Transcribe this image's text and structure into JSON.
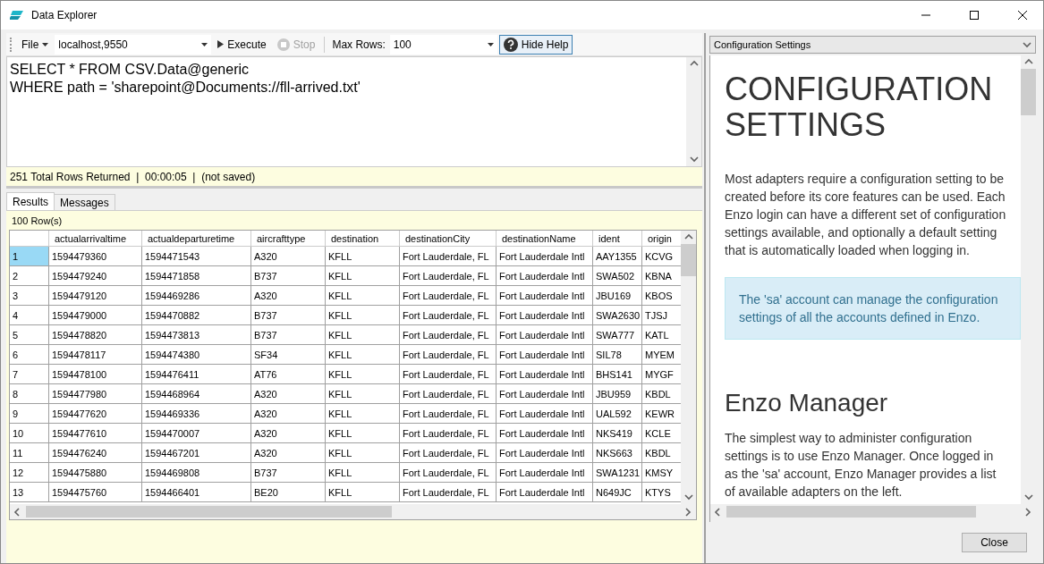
{
  "window": {
    "title": "Data Explorer"
  },
  "toolbar": {
    "file_menu": "File",
    "server": "localhost,9550",
    "execute": "Execute",
    "stop": {
      "label": "Stop",
      "disabled": true
    },
    "max_rows_label": "Max Rows:",
    "max_rows": "100",
    "help_toggle": "Hide Help"
  },
  "query": [
    "SELECT * FROM CSV.Data@generic",
    "WHERE path = 'sharepoint@Documents://fll-arrived.txt'"
  ],
  "status_bar": "251 Total Rows Returned  |  00:00:05  |  (not saved)",
  "tabs": [
    {
      "label": "Results",
      "selected": true
    },
    {
      "label": "Messages",
      "selected": false
    }
  ],
  "row_count": "100 Row(s)",
  "table": {
    "columns": [
      "actualarrivaltime",
      "actualdeparturetime",
      "aircrafttype",
      "destination",
      "destinationCity",
      "destinationName",
      "ident",
      "origin"
    ],
    "rows": [
      {
        "number": "1",
        "selected": true,
        "cells": [
          "1594479360",
          "1594471543",
          "A320",
          "KFLL",
          "Fort Lauderdale, FL",
          "Fort Lauderdale Intl",
          "AAY1355",
          "KCVG"
        ]
      },
      {
        "number": "2",
        "selected": false,
        "cells": [
          "1594479240",
          "1594471858",
          "B737",
          "KFLL",
          "Fort Lauderdale, FL",
          "Fort Lauderdale Intl",
          "SWA502",
          "KBNA"
        ]
      },
      {
        "number": "3",
        "selected": false,
        "cells": [
          "1594479120",
          "1594469286",
          "A320",
          "KFLL",
          "Fort Lauderdale, FL",
          "Fort Lauderdale Intl",
          "JBU169",
          "KBOS"
        ]
      },
      {
        "number": "4",
        "selected": false,
        "cells": [
          "1594479000",
          "1594470882",
          "B737",
          "KFLL",
          "Fort Lauderdale, FL",
          "Fort Lauderdale Intl",
          "SWA2630",
          "TJSJ"
        ]
      },
      {
        "number": "5",
        "selected": false,
        "cells": [
          "1594478820",
          "1594473813",
          "B737",
          "KFLL",
          "Fort Lauderdale, FL",
          "Fort Lauderdale Intl",
          "SWA777",
          "KATL"
        ]
      },
      {
        "number": "6",
        "selected": false,
        "cells": [
          "1594478117",
          "1594474380",
          "SF34",
          "KFLL",
          "Fort Lauderdale, FL",
          "Fort Lauderdale Intl",
          "SIL78",
          "MYEM"
        ]
      },
      {
        "number": "7",
        "selected": false,
        "cells": [
          "1594478100",
          "1594476411",
          "AT76",
          "KFLL",
          "Fort Lauderdale, FL",
          "Fort Lauderdale Intl",
          "BHS141",
          "MYGF"
        ]
      },
      {
        "number": "8",
        "selected": false,
        "cells": [
          "1594477980",
          "1594468964",
          "A320",
          "KFLL",
          "Fort Lauderdale, FL",
          "Fort Lauderdale Intl",
          "JBU959",
          "KBDL"
        ]
      },
      {
        "number": "9",
        "selected": false,
        "cells": [
          "1594477620",
          "1594469336",
          "A320",
          "KFLL",
          "Fort Lauderdale, FL",
          "Fort Lauderdale Intl",
          "UAL592",
          "KEWR"
        ]
      },
      {
        "number": "10",
        "selected": false,
        "cells": [
          "1594477610",
          "1594470007",
          "A320",
          "KFLL",
          "Fort Lauderdale, FL",
          "Fort Lauderdale Intl",
          "NKS419",
          "KCLE"
        ]
      },
      {
        "number": "11",
        "selected": false,
        "cells": [
          "1594476240",
          "1594467201",
          "A320",
          "KFLL",
          "Fort Lauderdale, FL",
          "Fort Lauderdale Intl",
          "NKS663",
          "KBDL"
        ]
      },
      {
        "number": "12",
        "selected": false,
        "cells": [
          "1594475880",
          "1594469808",
          "B737",
          "KFLL",
          "Fort Lauderdale, FL",
          "Fort Lauderdale Intl",
          "SWA1231",
          "KMSY"
        ]
      },
      {
        "number": "13",
        "selected": false,
        "cells": [
          "1594475760",
          "1594466401",
          "BE20",
          "KFLL",
          "Fort Lauderdale, FL",
          "Fort Lauderdale Intl",
          "N649JC",
          "KTYS"
        ]
      }
    ]
  },
  "help": {
    "topic": "Configuration Settings",
    "blocks": [
      {
        "kind": "title",
        "text": "CONFIGURATION SETTINGS"
      },
      {
        "kind": "paragraph",
        "text": "Most adapters require a configuration setting to be created before its core features can be used. Each Enzo login can have a different set of configuration settings available, and optionally a default setting that is automatically loaded when logging in."
      },
      {
        "kind": "note",
        "text": "The 'sa' account can manage the configuration settings of all the accounts defined in Enzo."
      },
      {
        "kind": "heading",
        "text": "Enzo Manager"
      },
      {
        "kind": "paragraph",
        "text": "The simplest way to administer configuration settings is to use Enzo Manager. Once logged in as the 'sa' account, Enzo Manager provides a list of available adapters on the left."
      }
    ]
  },
  "buttons": [
    "Close"
  ]
}
